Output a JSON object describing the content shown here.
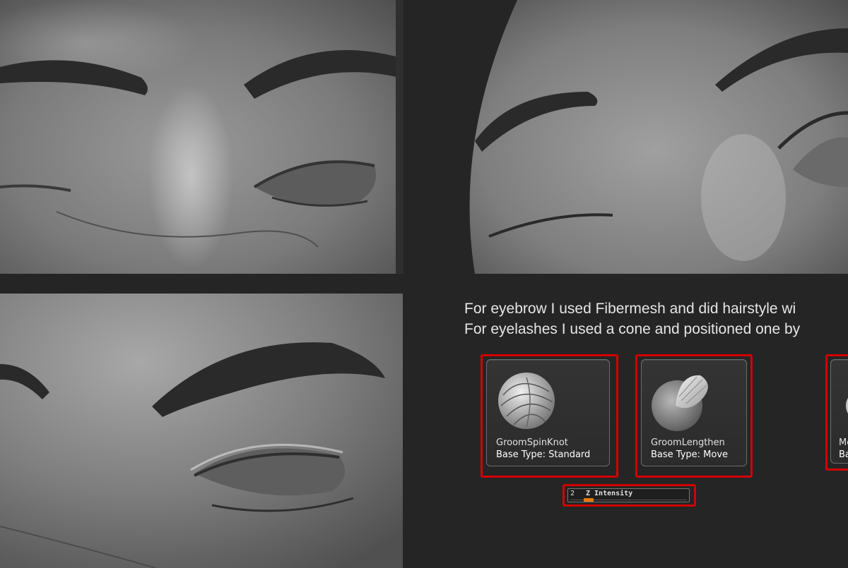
{
  "panels": {
    "top_left": "sculpt-render-front-eyes",
    "top_right": "sculpt-render-side-eyes",
    "bottom_left": "sculpt-render-eye-closeup"
  },
  "note": {
    "line1": "For eyebrow I used Fibermesh and did hairstyle wi",
    "line2": "For eyelashes I used a cone and positioned one by"
  },
  "brushes": [
    {
      "name": "GroomSpinKnot",
      "base_type": "Base Type: Standard",
      "icon": "groom-spin-knot-icon"
    },
    {
      "name": "GroomLengthen",
      "base_type": "Base Type: Move",
      "icon": "groom-lengthen-icon"
    },
    {
      "name": "Me",
      "base_type": "Ba",
      "icon": "brush-icon"
    }
  ],
  "slider": {
    "value": "2",
    "label": "Z Intensity",
    "fill_fraction": 0.02
  },
  "colors": {
    "highlight": "#d40000",
    "accent": "#e57a11",
    "background": "#252525"
  }
}
